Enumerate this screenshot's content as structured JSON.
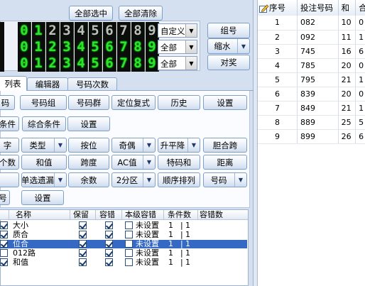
{
  "top_buttons": {
    "select_all": "全部选中",
    "clear_all": "全部清除"
  },
  "digit_rows": [
    {
      "digits": [
        "0",
        "1",
        "2",
        "3",
        "4",
        "5",
        "6",
        "7",
        "8",
        "9"
      ],
      "on": [
        1,
        1,
        0,
        0,
        0,
        0,
        0,
        0,
        0,
        0
      ],
      "select": "自定义"
    },
    {
      "digits": [
        "0",
        "1",
        "2",
        "3",
        "4",
        "5",
        "6",
        "7",
        "8",
        "9"
      ],
      "on": [
        1,
        1,
        1,
        1,
        1,
        1,
        1,
        1,
        1,
        1
      ],
      "select": "全部"
    },
    {
      "digits": [
        "0",
        "1",
        "2",
        "3",
        "4",
        "5",
        "6",
        "7",
        "8",
        "9"
      ],
      "on": [
        1,
        1,
        1,
        1,
        1,
        1,
        1,
        1,
        1,
        1
      ],
      "select": "全部"
    }
  ],
  "right_buttons": {
    "group": "组号",
    "shrink": "缩水",
    "match": "对奖"
  },
  "tabs": [
    "列表",
    "编辑器",
    "号码次数"
  ],
  "rows": {
    "r1": [
      "码",
      "号码组",
      "号码群",
      "定位复式",
      "历史",
      "设置"
    ],
    "r2": [
      "条件",
      "综合条件",
      "设置"
    ],
    "r3": [
      "字",
      "类型",
      "按位",
      "奇偶",
      "升平降",
      "胆合跨"
    ],
    "r4": [
      "个数",
      "和值",
      "跨度",
      "AC值",
      "特码和",
      "距离"
    ],
    "r5": [
      "",
      "单选遗漏",
      "余数",
      "2分区",
      "顺序排列",
      "号码"
    ],
    "r6": [
      "号",
      "设置"
    ]
  },
  "grid": {
    "headers": [
      "名称",
      "保留",
      "容错",
      "本级容错",
      "条件数",
      "容错数"
    ],
    "rows": [
      {
        "name": "大小",
        "keep": true,
        "tol": true,
        "level_label": "未设置",
        "cond": "1",
        "tolcount": "1",
        "sel": false
      },
      {
        "name": "质合",
        "keep": true,
        "tol": true,
        "level_label": "未设置",
        "cond": "1",
        "tolcount": "1",
        "sel": false
      },
      {
        "name": "位合",
        "keep": true,
        "tol": true,
        "level_label": "未设置",
        "cond": "1",
        "tolcount": "1",
        "sel": true
      },
      {
        "name": "012路",
        "keep": true,
        "tol": true,
        "level_label": "未设置",
        "cond": "1",
        "tolcount": "1",
        "sel": false
      },
      {
        "name": "和值",
        "keep": true,
        "tol": true,
        "level_label": "未设置",
        "cond": "1",
        "tolcount": "1",
        "sel": false
      }
    ]
  },
  "result_table": {
    "headers": [
      "序号",
      "投注号码",
      "和",
      "合"
    ],
    "rows": [
      [
        "1",
        "082",
        "10",
        "0"
      ],
      [
        "2",
        "092",
        "11",
        "1"
      ],
      [
        "3",
        "745",
        "16",
        "6"
      ],
      [
        "4",
        "785",
        "20",
        "0"
      ],
      [
        "5",
        "795",
        "21",
        "1"
      ],
      [
        "6",
        "839",
        "20",
        "0"
      ],
      [
        "7",
        "849",
        "21",
        "1"
      ],
      [
        "8",
        "889",
        "25",
        "5"
      ],
      [
        "9",
        "899",
        "26",
        "6"
      ]
    ]
  },
  "colors": {
    "accent": "#3569c4",
    "led_on": "#2fe22f",
    "led_off": "#b9c2b9",
    "panel": "#d5e1f0"
  }
}
